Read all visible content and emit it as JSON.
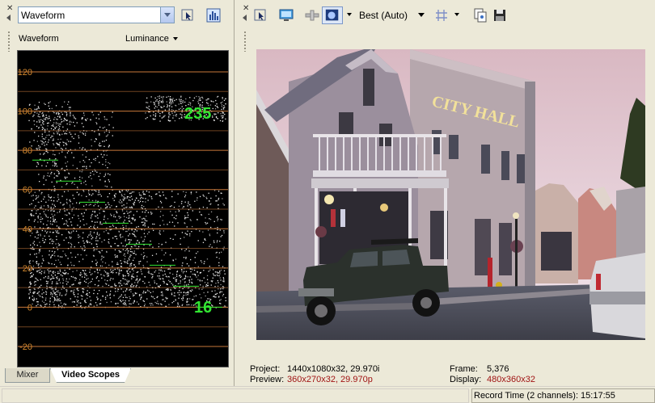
{
  "left_panel": {
    "scope_selector": {
      "value": "Waveform"
    },
    "scope_label": "Waveform",
    "scope_mode": "Luminance",
    "tabs": [
      {
        "label": "Mixer",
        "active": false
      },
      {
        "label": "Video Scopes",
        "active": true
      }
    ]
  },
  "waveform": {
    "y_ticks": [
      "120",
      "100",
      "80",
      "60",
      "40",
      "20",
      "0",
      "-20"
    ],
    "y_values": [
      120,
      100,
      80,
      60,
      40,
      20,
      0,
      -20
    ],
    "ylim": [
      -25,
      128
    ],
    "white_level": "235",
    "black_level": "16",
    "grid_color": "#c8783a",
    "label_color": "#d2882e",
    "marker_color": "#32e632"
  },
  "preview": {
    "quality": "Best (Auto)",
    "sign_text": "CITY HALL"
  },
  "info": {
    "project_label": "Project:",
    "project_value": "1440x1080x32, 29.970i",
    "preview_label": "Preview:",
    "preview_value": "360x270x32, 29.970p",
    "frame_label": "Frame:",
    "frame_value": "5,376",
    "display_label": "Display:",
    "display_value": "480x360x32"
  },
  "status": {
    "record_time": "Record Time (2 channels): 15:17:55"
  },
  "icons": {
    "close": "close-icon",
    "pin": "pin-arrow-icon",
    "grip": "grip-icon"
  }
}
